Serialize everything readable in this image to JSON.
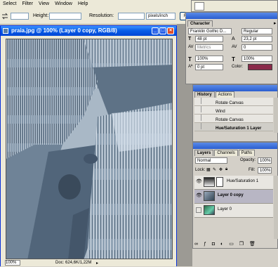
{
  "menubar": {
    "items": [
      "Select",
      "Filter",
      "View",
      "Window",
      "Help"
    ]
  },
  "options": {
    "height_label": "Height:",
    "resolution_label": "Resolution:",
    "units_value": "pixels/inch",
    "front_image_label": "Front Image"
  },
  "document": {
    "title": "praia.jpg @ 100% (Layer 0 copy, RGB/8)",
    "zoom": "100%",
    "doc_size": "Doc: 624,6K/1,22M"
  },
  "character": {
    "tab": "Character",
    "font_family": "Franklin Gothic D...",
    "font_style": "Regular",
    "font_size": "48 pt",
    "leading": "23,2 pt",
    "kerning": "Metrics",
    "tracking": "0",
    "vscale": "100%",
    "hscale": "100%",
    "baseline": "0 pt",
    "color_label": "Color:",
    "color_value": "#8a2a4a",
    "t_icon": "T"
  },
  "history": {
    "tabs": [
      "History",
      "Actions"
    ],
    "items": [
      "Rotate Canvas",
      "Wind",
      "Rotate Canvas",
      "Hue/Saturation 1 Layer"
    ]
  },
  "layers": {
    "tabs": [
      "Layers",
      "Channels",
      "Paths"
    ],
    "blend_mode": "Normal",
    "opacity_label": "Opacity:",
    "opacity_value": "100%",
    "lock_label": "Lock:",
    "fill_label": "Fill:",
    "fill_value": "100%",
    "items": [
      {
        "name": "Hue/Saturation 1"
      },
      {
        "name": "Layer 0 copy"
      },
      {
        "name": "Layer 0"
      }
    ]
  }
}
